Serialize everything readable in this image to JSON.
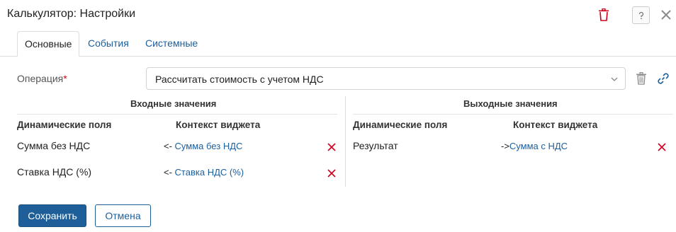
{
  "window": {
    "title": "Калькулятор: Настройки",
    "icons": {
      "delete": "trash-icon",
      "help": "help-icon",
      "close": "close-icon"
    }
  },
  "tabs": [
    {
      "label": "Основные",
      "active": true
    },
    {
      "label": "События",
      "active": false
    },
    {
      "label": "Системные",
      "active": false
    }
  ],
  "operation": {
    "label": "Операция",
    "required_mark": "*",
    "value": "Рассчитать стоимость с учетом НДС"
  },
  "inputs": {
    "title": "Входные значения",
    "col_fields": "Динамические поля",
    "col_context": "Контекст виджета",
    "rows": [
      {
        "name": "Сумма без НДС",
        "arrow": "<-",
        "context": "Сумма без НДС"
      },
      {
        "name": "Ставка НДС (%)",
        "arrow": "<-",
        "context": "Ставка НДС (%)"
      }
    ]
  },
  "outputs": {
    "title": "Выходные значения",
    "col_fields": "Динамические поля",
    "col_context": "Контекст виджета",
    "rows": [
      {
        "name": "Результат",
        "arrow": "->",
        "context": "Сумма с НДС"
      }
    ]
  },
  "buttons": {
    "save": "Сохранить",
    "cancel": "Отмена"
  },
  "colors": {
    "accent": "#1f5f99",
    "link": "#1a5f9e",
    "danger": "#d0021b"
  }
}
